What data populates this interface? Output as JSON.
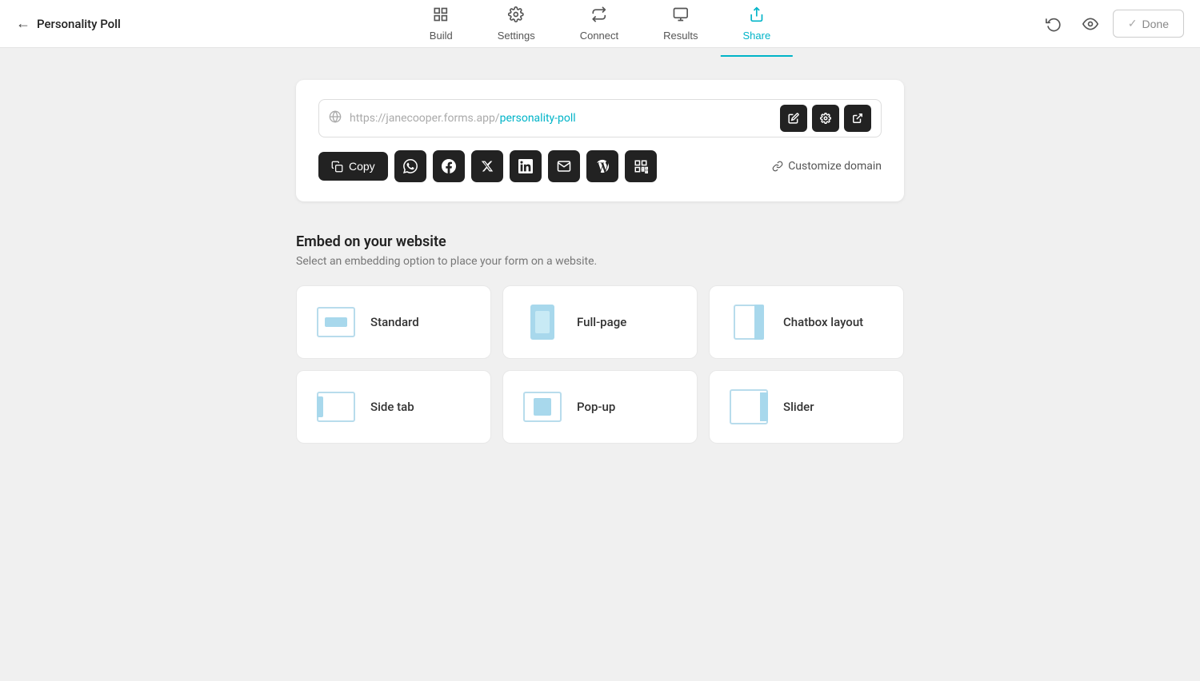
{
  "app": {
    "title": "Personality Poll",
    "back_label": "←"
  },
  "topnav": {
    "tabs": [
      {
        "id": "build",
        "label": "Build",
        "icon": "⚡",
        "active": false
      },
      {
        "id": "settings",
        "label": "Settings",
        "icon": "⚙",
        "active": false
      },
      {
        "id": "connect",
        "label": "Connect",
        "icon": "⇄",
        "active": false
      },
      {
        "id": "results",
        "label": "Results",
        "icon": "📊",
        "active": false
      },
      {
        "id": "share",
        "label": "Share",
        "icon": "↪",
        "active": true
      }
    ],
    "done_label": "Done",
    "check_icon": "✓"
  },
  "share": {
    "url_prefix": "https://",
    "url_domain": "janecooper.forms.app/",
    "url_slug": "personality-poll",
    "edit_tooltip": "Edit",
    "settings_tooltip": "Settings",
    "open_tooltip": "Open",
    "copy_label": "Copy",
    "customize_domain_label": "Customize domain",
    "social_buttons": [
      {
        "id": "whatsapp",
        "icon": "W",
        "label": "WhatsApp"
      },
      {
        "id": "facebook",
        "icon": "f",
        "label": "Facebook"
      },
      {
        "id": "twitter",
        "icon": "𝕏",
        "label": "Twitter"
      },
      {
        "id": "linkedin",
        "icon": "in",
        "label": "LinkedIn"
      },
      {
        "id": "email",
        "icon": "✉",
        "label": "Email"
      },
      {
        "id": "wordpress",
        "icon": "W",
        "label": "WordPress"
      },
      {
        "id": "qr",
        "icon": "▦",
        "label": "QR Code"
      }
    ]
  },
  "embed": {
    "title": "Embed on your website",
    "subtitle": "Select an embedding option to place your form on a website.",
    "options": [
      {
        "id": "standard",
        "label": "Standard"
      },
      {
        "id": "fullpage",
        "label": "Full-page"
      },
      {
        "id": "chatbox",
        "label": "Chatbox layout"
      },
      {
        "id": "sidetab",
        "label": "Side tab"
      },
      {
        "id": "popup",
        "label": "Pop-up"
      },
      {
        "id": "slider",
        "label": "Slider"
      }
    ]
  },
  "colors": {
    "accent": "#00b4c8",
    "dark_btn": "#222222",
    "thumb_fill": "#a8d8ec",
    "thumb_border": "#b8dcec"
  }
}
